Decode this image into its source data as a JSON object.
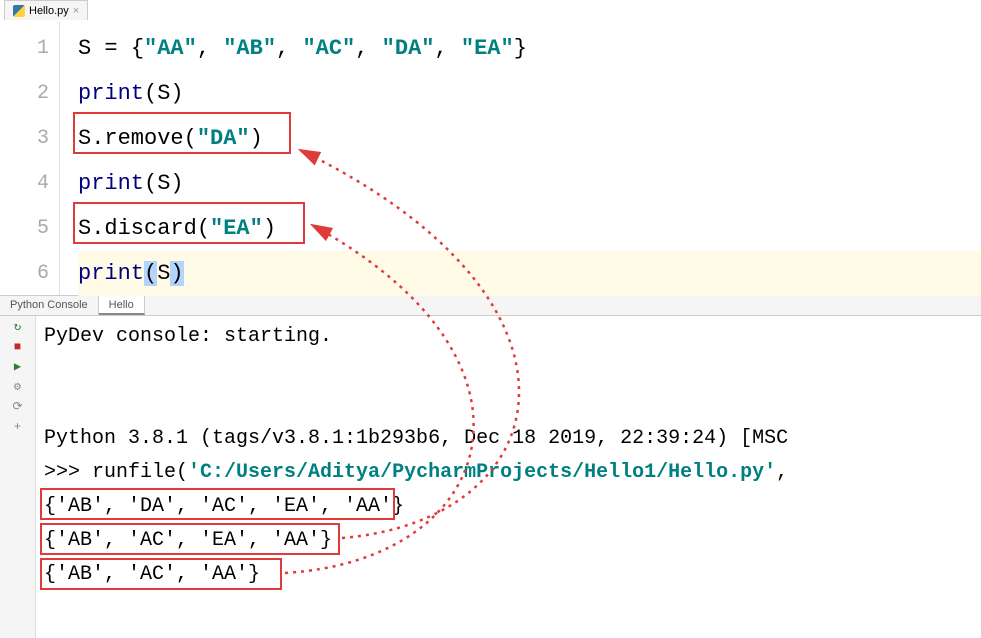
{
  "editor": {
    "filename": "Hello.py",
    "lines": {
      "l1": {
        "var": "S",
        "op": " = ",
        "lb": "{",
        "s1": "\"AA\"",
        "c1": ", ",
        "s2": "\"AB\"",
        "c2": ", ",
        "s3": "\"AC\"",
        "c3": ", ",
        "s4": "\"DA\"",
        "c4": ", ",
        "s5": "\"EA\"",
        "rb": "}"
      },
      "l2": {
        "fn": "print",
        "lp": "(",
        "arg": "S",
        "rp": ")"
      },
      "l3": {
        "obj": "S",
        "dot": ".",
        "mth": "remove",
        "lp": "(",
        "arg": "\"DA\"",
        "rp": ")"
      },
      "l4": {
        "fn": "print",
        "lp": "(",
        "arg": "S",
        "rp": ")"
      },
      "l5": {
        "obj": "S",
        "dot": ".",
        "mth": "discard",
        "lp": "(",
        "arg": "\"EA\"",
        "rp": ")"
      },
      "l6": {
        "fn": "print",
        "lp": "(",
        "arg": "S",
        "rp": ")"
      }
    },
    "line_numbers": [
      "1",
      "2",
      "3",
      "4",
      "5",
      "6"
    ]
  },
  "console": {
    "tab_console": "Python Console",
    "tab_run": "Hello",
    "banner": "PyDev console: starting.",
    "version": "Python 3.8.1 (tags/v3.8.1:1b293b6, Dec 18 2019, 22:39:24) [MSC",
    "prompt": ">>> ",
    "runfile_pre": "runfile(",
    "runfile_path": "'C:/Users/Aditya/PycharmProjects/Hello1/Hello.py'",
    "runfile_post": ",",
    "out1": "{'AB', 'DA', 'AC', 'EA', 'AA'}",
    "out2": "{'AB', 'AC', 'EA', 'AA'}",
    "out3": "{'AB', 'AC', 'AA'}"
  },
  "icons": {
    "rerun": "↻",
    "stop": "■",
    "play": "▶",
    "debug": "⚙",
    "link": "⟳",
    "add": "+"
  }
}
